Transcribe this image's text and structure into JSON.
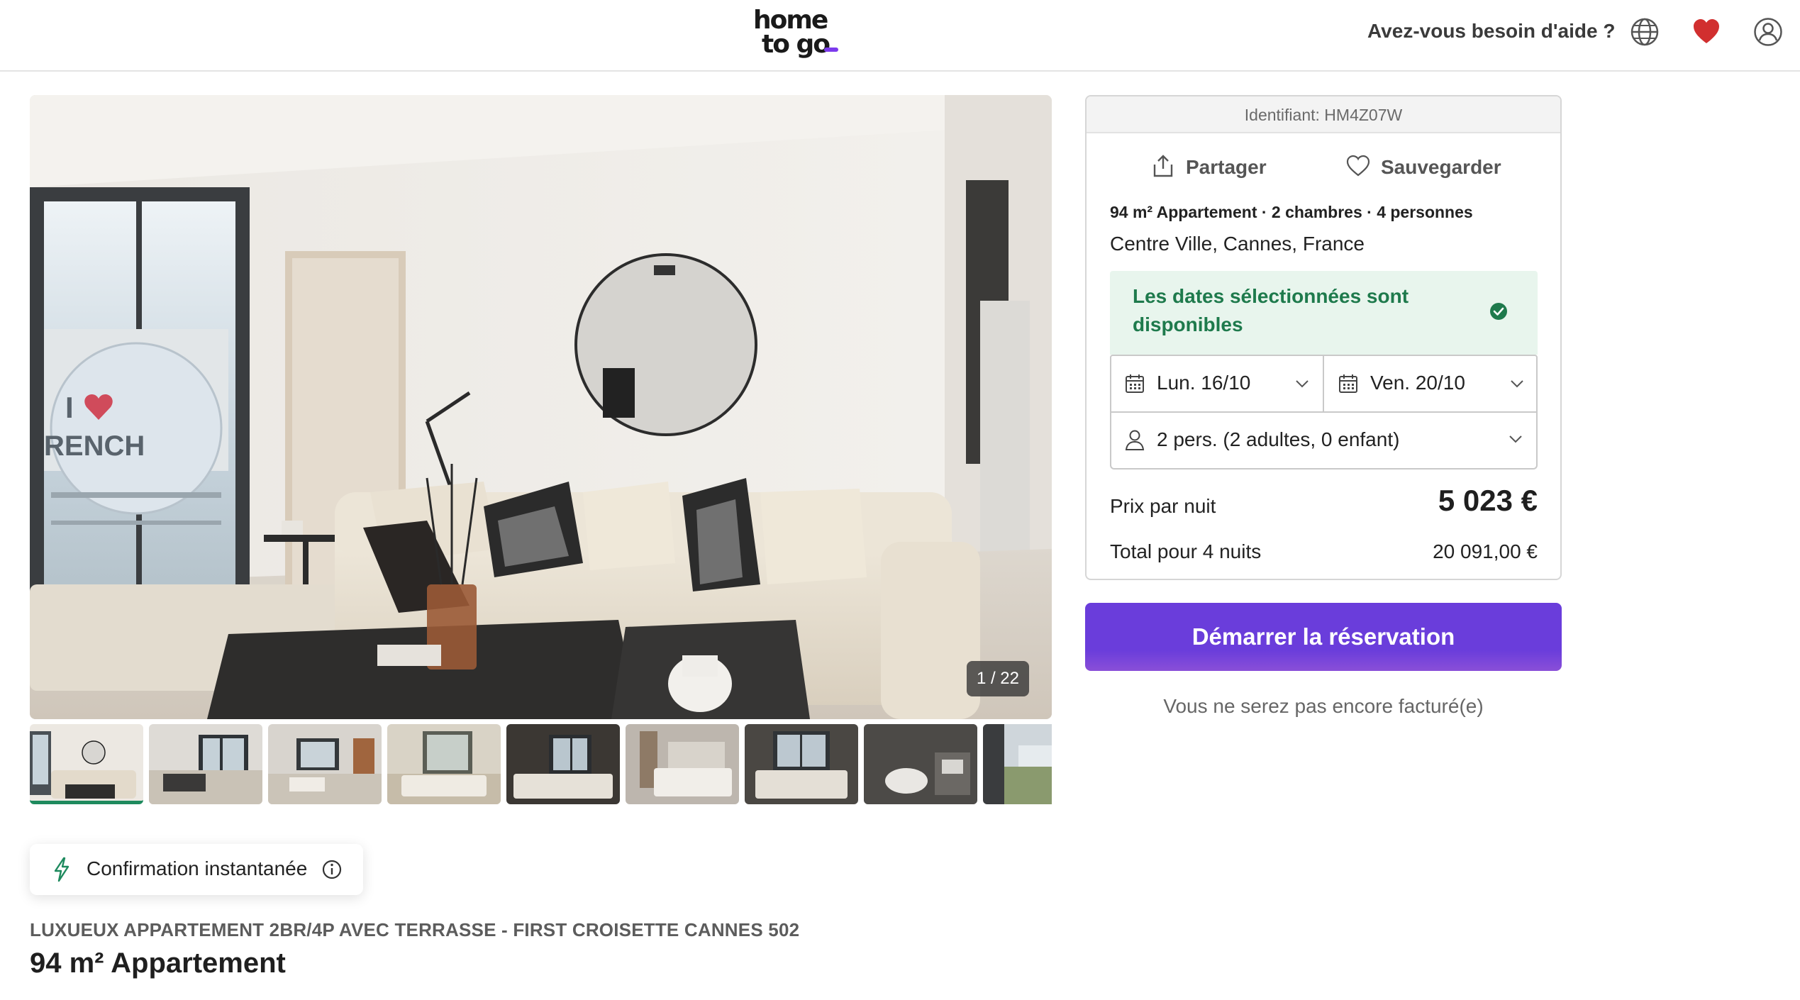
{
  "header": {
    "logo_line1": "home",
    "logo_line2": "to go",
    "help_label": "Avez-vous besoin d'aide ?",
    "icons": [
      "globe-icon",
      "heart-icon",
      "user-icon"
    ],
    "accent_color": "#7c3aed",
    "favorite_color": "#d12f2f"
  },
  "gallery": {
    "counter": "1 / 22",
    "thumbnails": [
      "thumb-1",
      "thumb-2",
      "thumb-3",
      "thumb-4",
      "thumb-5",
      "thumb-6",
      "thumb-7",
      "thumb-8",
      "thumb-9"
    ],
    "active_index": 0
  },
  "badge": {
    "instant_label": "Confirmation instantanée"
  },
  "listing": {
    "subtitle": "LUXUEUX APPARTEMENT 2BR/4P AVEC TERRASSE - FIRST CROISETTE CANNES 502",
    "title": "94 m² Appartement"
  },
  "booking": {
    "identifier": "Identifiant: HM4Z07W",
    "share_label": "Partager",
    "save_label": "Sauvegarder",
    "summary": "94 m² Appartement · 2 chambres · 4 personnes",
    "location": "Centre Ville, Cannes, France",
    "availability": "Les dates sélectionnées sont disponibles",
    "availability_color": "#1e7a4c",
    "checkin": "Lun. 16/10",
    "checkout": "Ven. 20/10",
    "guests": "2 pers. (2 adultes, 0 enfant)",
    "price_label": "Prix par nuit",
    "price_value": "5 023 €",
    "total_label": "Total pour 4 nuits",
    "total_value": "20 091,00 €",
    "cta_label": "Démarrer la réservation",
    "cta_color": "#6a3ddb",
    "cta_note": "Vous ne serez pas encore facturé(e)"
  }
}
